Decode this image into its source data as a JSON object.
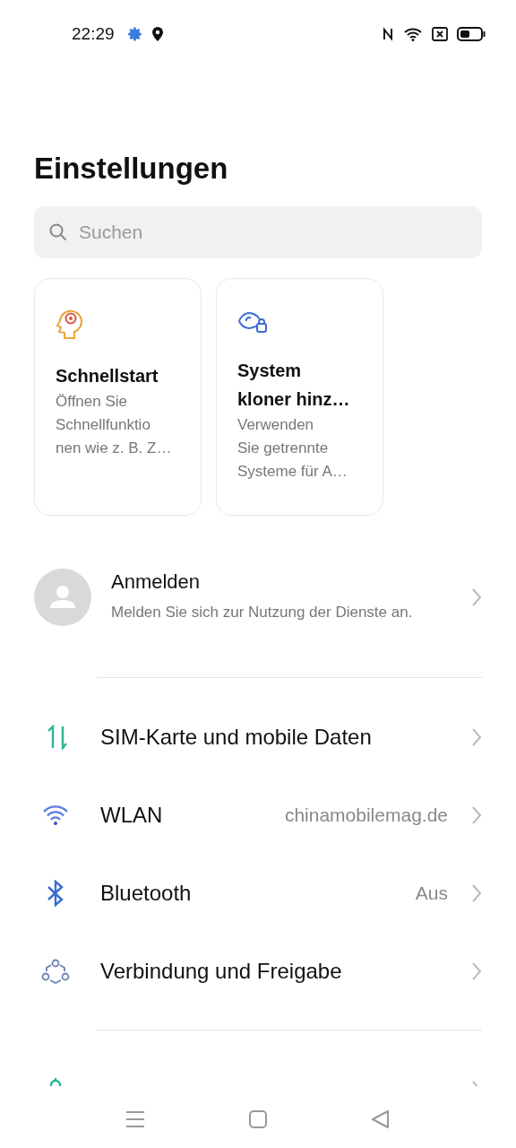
{
  "status_bar": {
    "time": "22:29"
  },
  "title": "Einstellungen",
  "search": {
    "placeholder": "Suchen"
  },
  "cards": [
    {
      "kind": "quickstart",
      "title_lines": [
        "Schnellstart"
      ],
      "description_lines": [
        "Öffnen Sie",
        "Schnellfunktio",
        "nen wie z. B. Z…"
      ]
    },
    {
      "kind": "clone",
      "title_lines": [
        "System",
        "kloner hinz…"
      ],
      "description_lines": [
        "Verwenden",
        "Sie getrennte",
        "Systeme für A…"
      ]
    }
  ],
  "account": {
    "title": "Anmelden",
    "subtitle": "Melden Sie sich zur Nutzung der Dienste an."
  },
  "groups": [
    [
      {
        "kind": "sim",
        "label": "SIM-Karte und mobile Daten"
      },
      {
        "kind": "wlan",
        "label": "WLAN",
        "value": "chinamobilemag.de"
      },
      {
        "kind": "bluetooth",
        "label": "Bluetooth",
        "value": "Aus"
      },
      {
        "kind": "sharing",
        "label": "Verbindung und Freigabe"
      }
    ],
    [
      {
        "kind": "personal"
      }
    ]
  ]
}
